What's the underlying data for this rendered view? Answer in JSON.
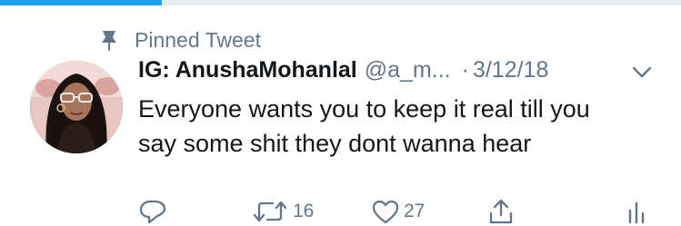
{
  "pinned": {
    "label": "Pinned Tweet"
  },
  "tweet": {
    "display_name": "IG: AnushaMohanlal",
    "handle": "@a_m...",
    "separator": "·",
    "timestamp": "3/12/18",
    "text_lines": [
      "Everyone wants you to keep it real till you",
      "say some shit they dont wanna hear"
    ]
  },
  "actions": {
    "reply": {
      "icon": "reply-icon",
      "count": ""
    },
    "retweet": {
      "icon": "retweet-icon",
      "count": "16"
    },
    "like": {
      "icon": "heart-icon",
      "count": "27"
    },
    "share": {
      "icon": "share-icon"
    },
    "analytics": {
      "icon": "analytics-icon"
    }
  },
  "colors": {
    "accent": "#1da1f2",
    "text_primary": "#14171a",
    "text_secondary": "#657786"
  }
}
